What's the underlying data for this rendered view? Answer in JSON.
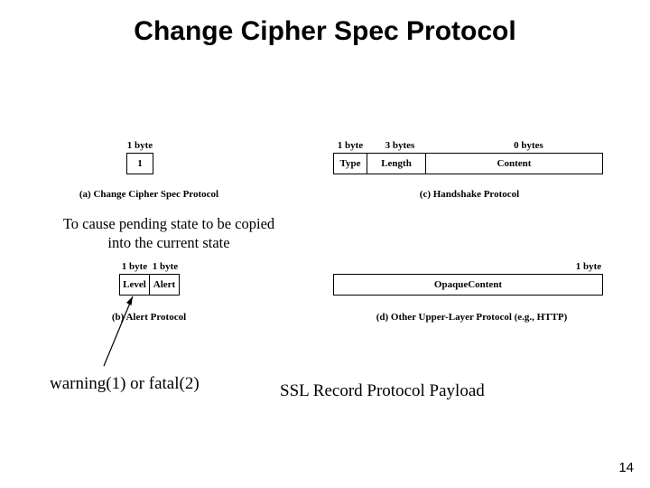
{
  "title": "Change Cipher Spec Protocol",
  "a": {
    "bytelabel": "1 byte",
    "cell": "1",
    "caption": "(a) Change Cipher Spec Protocol"
  },
  "c": {
    "bytes": {
      "type": "1 byte",
      "length": "3 bytes",
      "content": "0 bytes"
    },
    "cells": {
      "type": "Type",
      "length": "Length",
      "content": "Content"
    },
    "caption": "(c) Handshake Protocol"
  },
  "note_a": "To cause pending state to be copied\ninto the current state",
  "b": {
    "bytes": {
      "level": "1 byte",
      "alert": "1 byte"
    },
    "cells": {
      "level": "Level",
      "alert": "Alert"
    },
    "caption": "(b) Alert Protocol"
  },
  "d": {
    "bytelabel": "1 byte",
    "cell": "OpaqueContent",
    "caption": "(d) Other Upper-Layer Protocol (e.g., HTTP)"
  },
  "note_warning": "warning(1) or fatal(2)",
  "note_payload": "SSL Record Protocol Payload",
  "page": "14"
}
